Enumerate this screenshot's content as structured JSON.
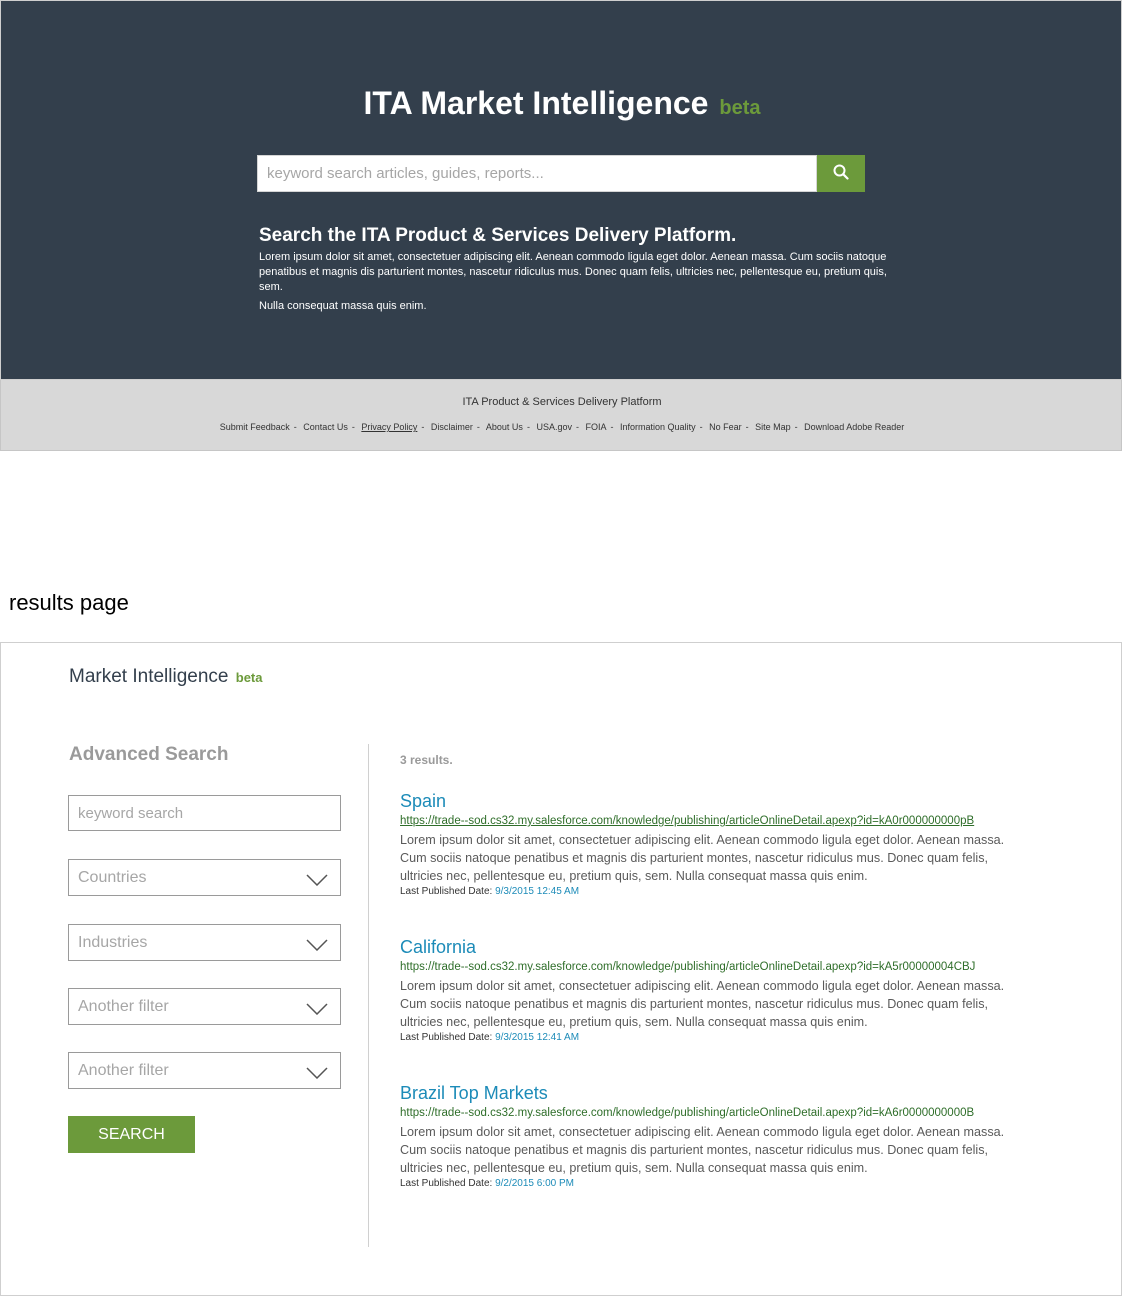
{
  "landing": {
    "title": "ITA Market Intelligence",
    "beta": "beta",
    "search_placeholder": "keyword search articles, guides, reports...",
    "heading": "Search the ITA Product & Services Delivery Platform.",
    "body_line1": "Lorem ipsum dolor sit amet, consectetuer adipiscing elit. Aenean commodo ligula eget dolor. Aenean massa. Cum sociis natoque",
    "body_line2": "penatibus et magnis dis parturient montes, nascetur ridiculus mus. Donec quam felis, ultricies nec, pellentesque eu, pretium quis, sem.",
    "body_line3": "Nulla consequat massa quis enim."
  },
  "footer": {
    "title": "ITA Product & Services Delivery Platform",
    "links": [
      "Submit Feedback",
      "Contact Us",
      "Privacy Policy",
      "Disclaimer",
      "About Us",
      "USA.gov",
      "FOIA",
      "Information Quality",
      "No Fear",
      "Site Map",
      "Download Adobe Reader"
    ],
    "separator": "-"
  },
  "section_label": "results page",
  "results_page": {
    "brand": "Market Intelligence",
    "beta": "beta",
    "advanced_search_title": "Advanced Search",
    "keyword_placeholder": "keyword search",
    "filters": [
      "Countries",
      "Industries",
      "Another filter",
      "Another filter"
    ],
    "search_button": "SEARCH",
    "result_count": "3 results.",
    "results": [
      {
        "title": "Spain",
        "url": "https://trade--sod.cs32.my.salesforce.com/knowledge/publishing/articleOnlineDetail.apexp?id=kA0r000000000pB",
        "desc_line1": "Lorem ipsum dolor sit amet, consectetuer adipiscing elit. Aenean commodo ligula eget dolor. Aenean massa.",
        "desc_line2": "Cum sociis natoque penatibus et magnis dis parturient montes, nascetur ridiculus mus. Donec quam felis,",
        "desc_line3": "ultricies nec, pellentesque eu, pretium quis, sem. Nulla consequat massa quis enim.",
        "date_label": "Last Published Date:",
        "date_value": "9/3/2015 12:45 AM"
      },
      {
        "title": "California",
        "url": "https://trade--sod.cs32.my.salesforce.com/knowledge/publishing/articleOnlineDetail.apexp?id=kA5r00000004CBJ",
        "desc_line1": "Lorem ipsum dolor sit amet, consectetuer adipiscing elit. Aenean commodo ligula eget dolor. Aenean massa.",
        "desc_line2": "Cum sociis natoque penatibus et magnis dis parturient montes, nascetur ridiculus mus. Donec quam felis,",
        "desc_line3": "ultricies nec, pellentesque eu, pretium quis, sem. Nulla consequat massa quis enim.",
        "date_label": "Last Published Date:",
        "date_value": "9/3/2015 12:41 AM"
      },
      {
        "title": "Brazil Top Markets",
        "url": "https://trade--sod.cs32.my.salesforce.com/knowledge/publishing/articleOnlineDetail.apexp?id=kA6r0000000000B",
        "desc_line1": "Lorem ipsum dolor sit amet, consectetuer adipiscing elit. Aenean commodo ligula eget dolor. Aenean massa.",
        "desc_line2": "Cum sociis natoque penatibus et magnis dis parturient montes, nascetur ridiculus mus. Donec quam felis,",
        "desc_line3": "ultricies nec, pellentesque eu, pretium quis, sem. Nulla consequat massa quis enim.",
        "date_label": "Last Published Date:",
        "date_value": "9/2/2015 6:00 PM"
      }
    ]
  },
  "colors": {
    "hero_bg": "#333f4c",
    "accent_green": "#6c9a3b",
    "link_blue": "#1c8bb8",
    "url_green": "#2f6e2a",
    "footer_bg": "#d8d8d8"
  },
  "icons": {
    "search": "search-icon",
    "dropdown": "chevron-down-icon"
  }
}
